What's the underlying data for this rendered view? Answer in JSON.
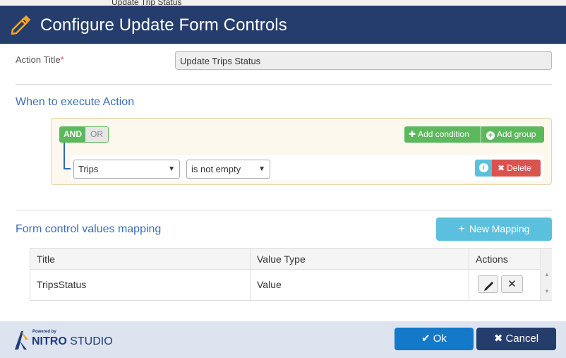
{
  "background": {
    "peek_text": "Update Trip Status"
  },
  "header": {
    "title": "Configure Update Form Controls",
    "icon": "pencil-icon",
    "color": "#253d6d"
  },
  "action_title": {
    "label": "Action Title",
    "required_mark": "*",
    "value": "Update Trips Status"
  },
  "when_section": {
    "heading": "When to execute Action",
    "and_label": "AND",
    "or_label": "OR",
    "add_condition_label": "Add condition",
    "add_group_label": "Add group",
    "rule": {
      "field": "Trips",
      "operator": "is not empty"
    },
    "info_icon": "info-icon",
    "delete_label": "Delete"
  },
  "mapping_section": {
    "heading": "Form control values mapping",
    "new_mapping_label": "New Mapping",
    "columns": [
      "Title",
      "Value Type",
      "Actions"
    ],
    "rows": [
      {
        "title": "TripsStatus",
        "value_type": "Value"
      }
    ]
  },
  "footer": {
    "logo_powered": "Powered by",
    "logo_brand_bold": "NITRO",
    "logo_brand_rest": " STUDIO",
    "ok_label": "Ok",
    "cancel_label": "Cancel"
  },
  "colors": {
    "accent_blue": "#3a6eb5",
    "green": "#5cb85c",
    "info": "#5bc0de",
    "danger": "#d9534f",
    "ok": "#1479c9"
  }
}
